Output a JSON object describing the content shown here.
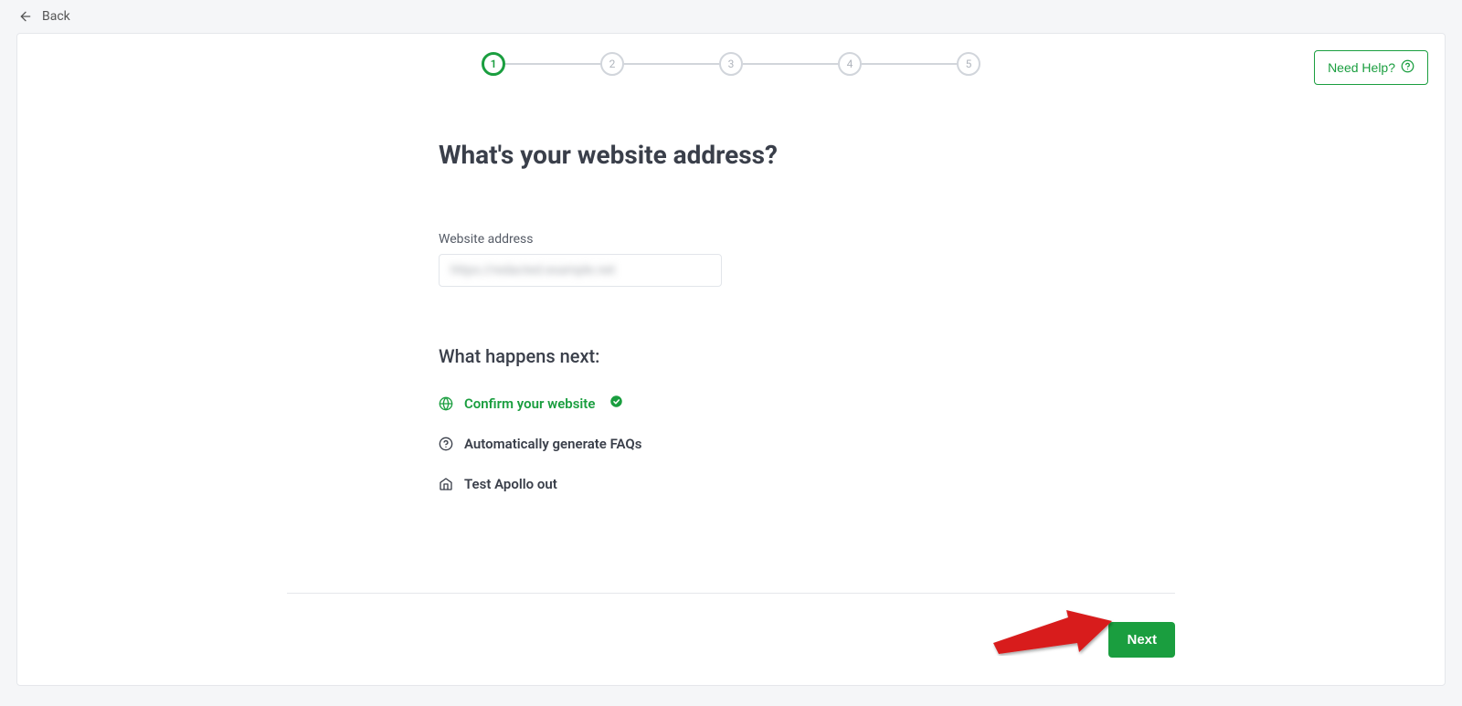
{
  "back_label": "Back",
  "help_label": "Need Help?",
  "stepper": {
    "steps": [
      "1",
      "2",
      "3",
      "4",
      "5"
    ],
    "active_index": 0
  },
  "heading": "What's your website address?",
  "field_label": "Website address",
  "url_value": "https://redacted.example.net",
  "subheading": "What happens next:",
  "next_steps": [
    {
      "label": "Confirm your website",
      "highlighted": true,
      "checked": true
    },
    {
      "label": "Automatically generate FAQs",
      "highlighted": false,
      "checked": false
    },
    {
      "label": "Test Apollo out",
      "highlighted": false,
      "checked": false
    }
  ],
  "next_button": "Next"
}
